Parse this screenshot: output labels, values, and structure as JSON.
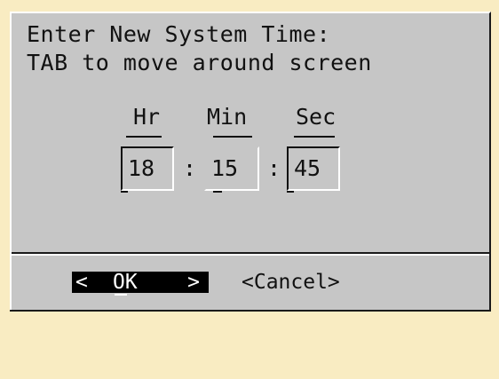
{
  "dialog": {
    "prompt_line1": "Enter New System Time:",
    "prompt_line2": "TAB to move around screen"
  },
  "time": {
    "labels": {
      "hour": "Hr",
      "minute": "Min",
      "second": "Sec"
    },
    "values": {
      "hour": "18",
      "minute": "15",
      "second": "45"
    },
    "separator": ":"
  },
  "buttons": {
    "ok": {
      "left": "<",
      "label": "OK",
      "right": ">"
    },
    "cancel": "<Cancel>"
  },
  "colors": {
    "background": "#f9ecc2",
    "dialog": "#c6c6c6",
    "selected_button_bg": "#000000",
    "selected_button_fg": "#ffffff"
  }
}
